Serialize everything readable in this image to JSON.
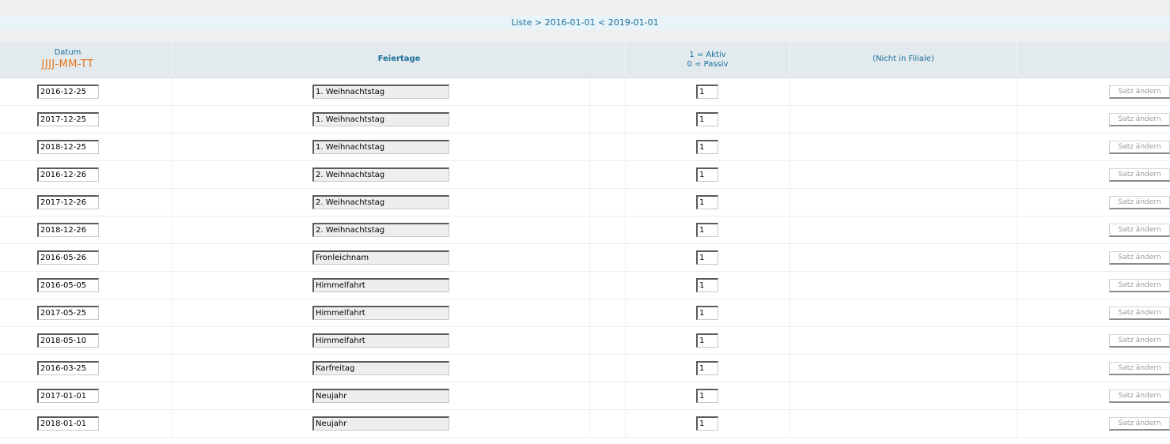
{
  "breadcrumb": "Liste > 2016-01-01 < 2019-01-01",
  "header": {
    "datum_label": "Datum",
    "datum_format": "JJJJ-MM-TT",
    "feiertage_label": "Feiertage",
    "aktiv_label": "1 = Aktiv",
    "passiv_label": "0 = Passiv",
    "filiale_label": "(Nicht in Filiale)"
  },
  "colors": {
    "accent_text": "#1a6e9a",
    "format_text": "#e8761e",
    "header_bg": "#e2eaee",
    "breadcrumb_bg": "#e8f4f8"
  },
  "rows": [
    {
      "date": "2016-12-25",
      "name": "1. Weihnachtstag",
      "flag": "1",
      "button": "Satz ändern"
    },
    {
      "date": "2017-12-25",
      "name": "1. Weihnachtstag",
      "flag": "1",
      "button": "Satz ändern"
    },
    {
      "date": "2018-12-25",
      "name": "1. Weihnachtstag",
      "flag": "1",
      "button": "Satz ändern"
    },
    {
      "date": "2016-12-26",
      "name": "2. Weihnachtstag",
      "flag": "1",
      "button": "Satz ändern"
    },
    {
      "date": "2017-12-26",
      "name": "2. Weihnachtstag",
      "flag": "1",
      "button": "Satz ändern"
    },
    {
      "date": "2018-12-26",
      "name": "2. Weihnachtstag",
      "flag": "1",
      "button": "Satz ändern"
    },
    {
      "date": "2016-05-26",
      "name": "Fronleichnam",
      "flag": "1",
      "button": "Satz ändern"
    },
    {
      "date": "2016-05-05",
      "name": "Himmelfahrt",
      "flag": "1",
      "button": "Satz ändern"
    },
    {
      "date": "2017-05-25",
      "name": "Himmelfahrt",
      "flag": "1",
      "button": "Satz ändern"
    },
    {
      "date": "2018-05-10",
      "name": "Himmelfahrt",
      "flag": "1",
      "button": "Satz ändern"
    },
    {
      "date": "2016-03-25",
      "name": "Karfreitag",
      "flag": "1",
      "button": "Satz ändern"
    },
    {
      "date": "2017-01-01",
      "name": "Neujahr",
      "flag": "1",
      "button": "Satz ändern"
    },
    {
      "date": "2018-01-01",
      "name": "Neujahr",
      "flag": "1",
      "button": "Satz ändern"
    }
  ]
}
